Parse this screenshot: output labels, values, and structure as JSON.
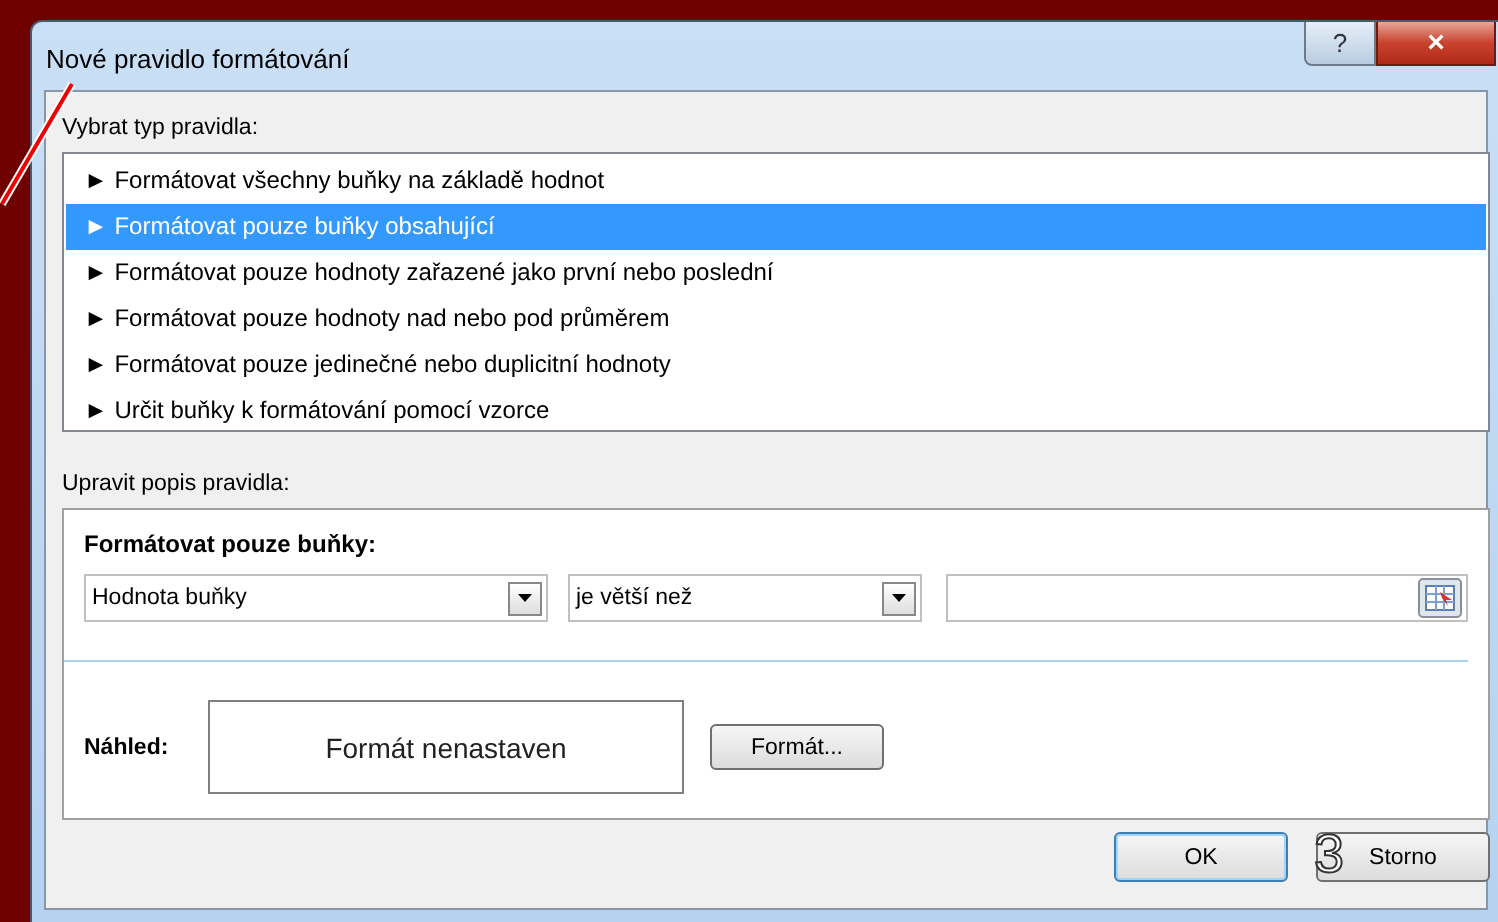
{
  "window": {
    "title": "Nové pravidlo formátování",
    "help_button": "?",
    "close_button": "×"
  },
  "rule_type": {
    "label": "Vybrat typ pravidla:",
    "items": [
      {
        "text": "Formátovat všechny buňky na základě hodnot",
        "selected": false
      },
      {
        "text": "Formátovat pouze buňky obsahující",
        "selected": true
      },
      {
        "text": "Formátovat pouze hodnoty zařazené jako první nebo poslední",
        "selected": false
      },
      {
        "text": "Formátovat pouze hodnoty nad nebo pod průměrem",
        "selected": false
      },
      {
        "text": "Formátovat pouze jedinečné nebo duplicitní hodnoty",
        "selected": false
      },
      {
        "text": "Určit buňky k formátování pomocí vzorce",
        "selected": false
      }
    ],
    "bullet": "►"
  },
  "description": {
    "label": "Upravit popis pravidla:",
    "heading": "Formátovat pouze buňky:",
    "field_select": {
      "value": "Hodnota buňky"
    },
    "operator_select": {
      "value": "je větší než"
    },
    "preview_label": "Náhled:",
    "preview_text": "Formát nenastaven",
    "format_button": "Formát..."
  },
  "buttons": [
    {
      "label": "OK",
      "default": true
    },
    {
      "label": "Storno",
      "default": false
    }
  ],
  "annotation": {
    "number": "3"
  }
}
